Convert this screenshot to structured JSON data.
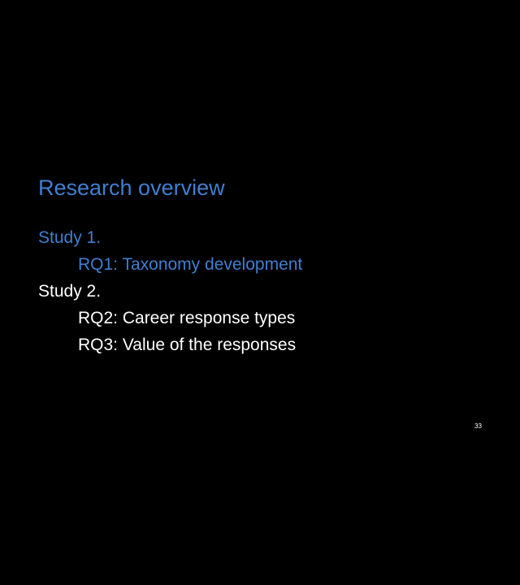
{
  "slide": {
    "title": "Research overview",
    "lines": [
      {
        "text": "Study 1.",
        "level": 1,
        "highlighted": true
      },
      {
        "text": "RQ1: Taxonomy development",
        "level": 2,
        "highlighted": true
      },
      {
        "text": "Study 2.",
        "level": 1,
        "highlighted": false
      },
      {
        "text": "RQ2: Career response types",
        "level": 2,
        "highlighted": false
      },
      {
        "text": "RQ3: Value of the responses",
        "level": 2,
        "highlighted": false
      }
    ],
    "slide_number": "33"
  },
  "colors": {
    "background": "#000000",
    "accent": "#3f7fd0",
    "text": "#ffffff"
  }
}
